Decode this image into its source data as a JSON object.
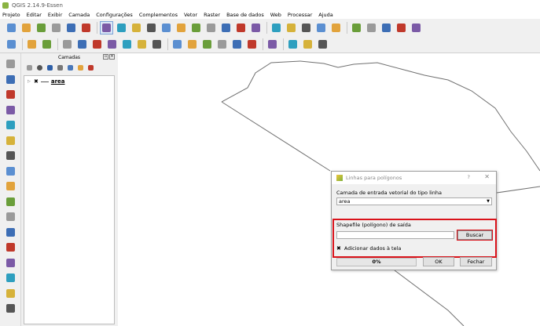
{
  "window": {
    "title": "QGIS 2.14.9-Essen"
  },
  "menubar": {
    "items": [
      "Projeto",
      "Editar",
      "Exibir",
      "Camada",
      "Configurações",
      "Complementos",
      "Vetor",
      "Raster",
      "Base de dados",
      "Web",
      "Processar",
      "Ajuda"
    ]
  },
  "toolbar_icons": {
    "row1": [
      "new-project",
      "open-project",
      "save-project",
      "save-as",
      "print-composer",
      "composer-manager",
      "pan-selection",
      "pan-icon",
      "pan-to-selection",
      "zoom-in",
      "zoom-out",
      "zoom-full",
      "zoom-selection",
      "zoom-layer",
      "zoom-last",
      "zoom-next",
      "refresh",
      "identify",
      "select-features",
      "deselect-features",
      "attribute-table",
      "statistics",
      "measure",
      "annotation",
      "map-tips",
      "label",
      "help"
    ],
    "row2": [
      "current-edits",
      "toggle-editing",
      "save-edits",
      "add-feature",
      "move-feature",
      "node-tool",
      "delete-selected",
      "cut-features",
      "copy-features",
      "paste-features",
      "label-tool",
      "pin-labels",
      "show-hide-labels",
      "move-label",
      "rotate-label",
      "change-label",
      "csw",
      "python-console",
      "wkt",
      "geometry-tool"
    ]
  },
  "left_toolbar_icons": [
    "add-vector-layer",
    "add-raster-layer",
    "add-postgis-layer",
    "add-spatialite-layer",
    "add-mssql-layer",
    "add-oracle-layer",
    "add-wms-layer",
    "add-wcs-layer",
    "add-wfs-layer",
    "add-delimited-text",
    "new-shapefile",
    "new-spatialite",
    "new-temporary",
    "add-feature",
    "digitize",
    "gps-tool",
    "georeferencer"
  ],
  "layers_panel": {
    "title": "Camadas",
    "layers": [
      {
        "name": "area",
        "checked": true,
        "checkmark": "✖"
      }
    ]
  },
  "dialog": {
    "title": "Linhas para polígonos",
    "help": "?",
    "close": "✕",
    "input_label": "Camada de entrada vetorial do tipo linha",
    "input_value": "area",
    "output_label": "Shapefile (polígono) de saída",
    "output_value": "",
    "browse_label": "Buscar",
    "add_to_canvas_label": "Adicionar dados à tela",
    "add_to_canvas_mark": "✖",
    "progress_text": "0%",
    "progress": 0,
    "ok_label": "OK",
    "close_label": "Fechar"
  },
  "colors": {
    "highlight": "#d9121a",
    "qgis_green": "#8ab342"
  }
}
